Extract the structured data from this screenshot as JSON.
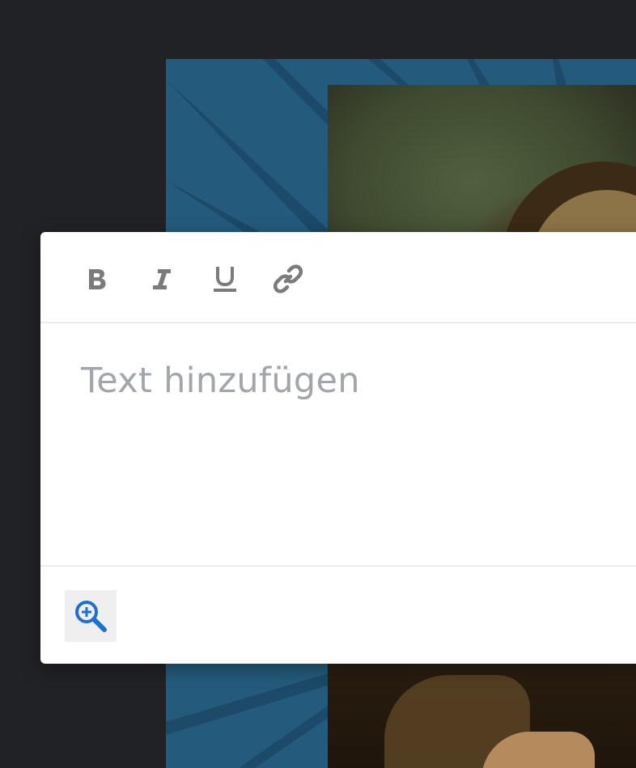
{
  "editor": {
    "placeholder": "Text hinzufügen",
    "toolbar": {
      "bold": "bold-icon",
      "italic": "italic-icon",
      "underline": "underline-icon",
      "link": "link-icon"
    },
    "footer": {
      "zoom": "zoom-in-icon"
    }
  },
  "colors": {
    "app_background": "#212226",
    "art_panel": "#245b7d",
    "toolbar_icon": "#7b7b7b",
    "placeholder_text": "#a1a6ad",
    "zoom_icon": "#1f6fd1",
    "zoom_button_bg": "#efefef"
  }
}
